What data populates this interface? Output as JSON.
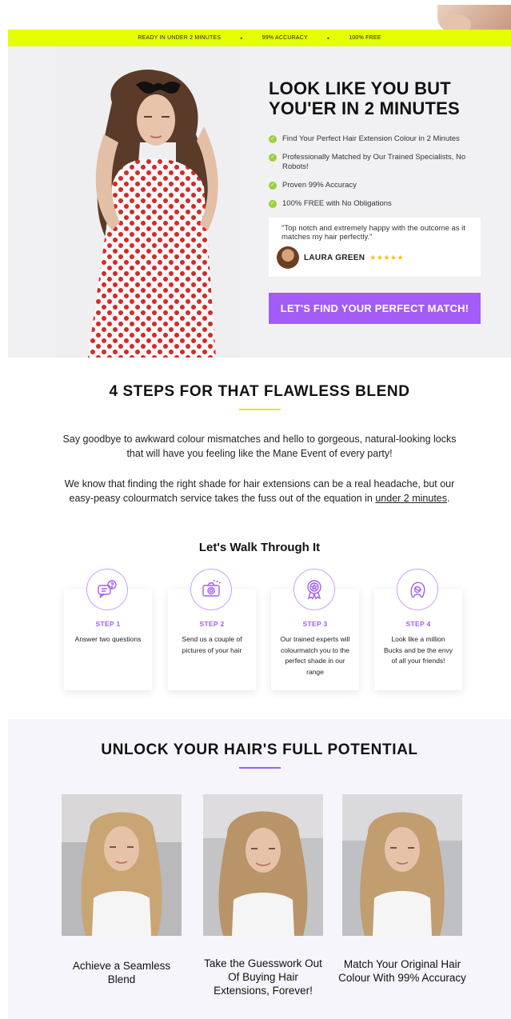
{
  "topbar": {
    "items": [
      "READY IN UNDER 2 MINUTES",
      "99% ACCURACY",
      "100% FREE"
    ]
  },
  "hero": {
    "title_line1": "LOOK LIKE YOU BUT",
    "title_line2": "YOU'ER IN 2 MINUTES",
    "benefits": [
      "Find Your Perfect Hair Extension Colour in 2 Minutes",
      "Professionally Matched by Our Trained Specialists, No Robots!",
      "Proven 99% Accuracy",
      "100% FREE with No Obligations"
    ],
    "review": {
      "quote": "\"Top notch and extremely happy with the outcome as it matches my hair perfectly.\"",
      "name": "LAURA GREEN",
      "stars": "★★★★★"
    },
    "cta_label": "LET'S FIND YOUR PERFECT MATCH!"
  },
  "steps_section": {
    "title": "4 STEPS FOR THAT FLAWLESS BLEND",
    "intro_p1": "Say goodbye to awkward colour mismatches and hello to gorgeous, natural-looking locks that will have you feeling like the Mane Event of every party!",
    "intro_p2_before": "We know that finding the right shade for hair extensions can be a real headache, but our easy-peasy colourmatch service takes the fuss out of the equation in ",
    "intro_p2_link": "under 2 minutes",
    "intro_p2_after": ".",
    "walk_title": "Let's Walk Through It",
    "steps": [
      {
        "label": "STEP 1",
        "text": "Answer two questions",
        "icon": "chat-question-icon"
      },
      {
        "label": "STEP 2",
        "text": "Send us a couple of pictures of your hair",
        "icon": "camera-icon"
      },
      {
        "label": "STEP 3",
        "text": "Our trained experts will colourmatch you to the perfect shade in our range",
        "icon": "award-badge-icon"
      },
      {
        "label": "STEP 4",
        "text": "Look like a million Bucks and be the envy of all your friends!",
        "icon": "hair-portrait-icon"
      }
    ]
  },
  "potential_section": {
    "title": "UNLOCK YOUR HAIR'S FULL POTENTIAL",
    "captions": [
      "Achieve a Seamless Blend",
      "Take the Guesswork Out Of Buying Hair Extensions, Forever!",
      "Match Your Original Hair Colour With 99% Accuracy"
    ]
  },
  "colors": {
    "topbar_bg": "#e6ff00",
    "accent_purple": "#a35cf5",
    "check_green": "#9ccf3c",
    "star_gold": "#f4c20d",
    "yellow_rule": "#d7ea1a"
  }
}
